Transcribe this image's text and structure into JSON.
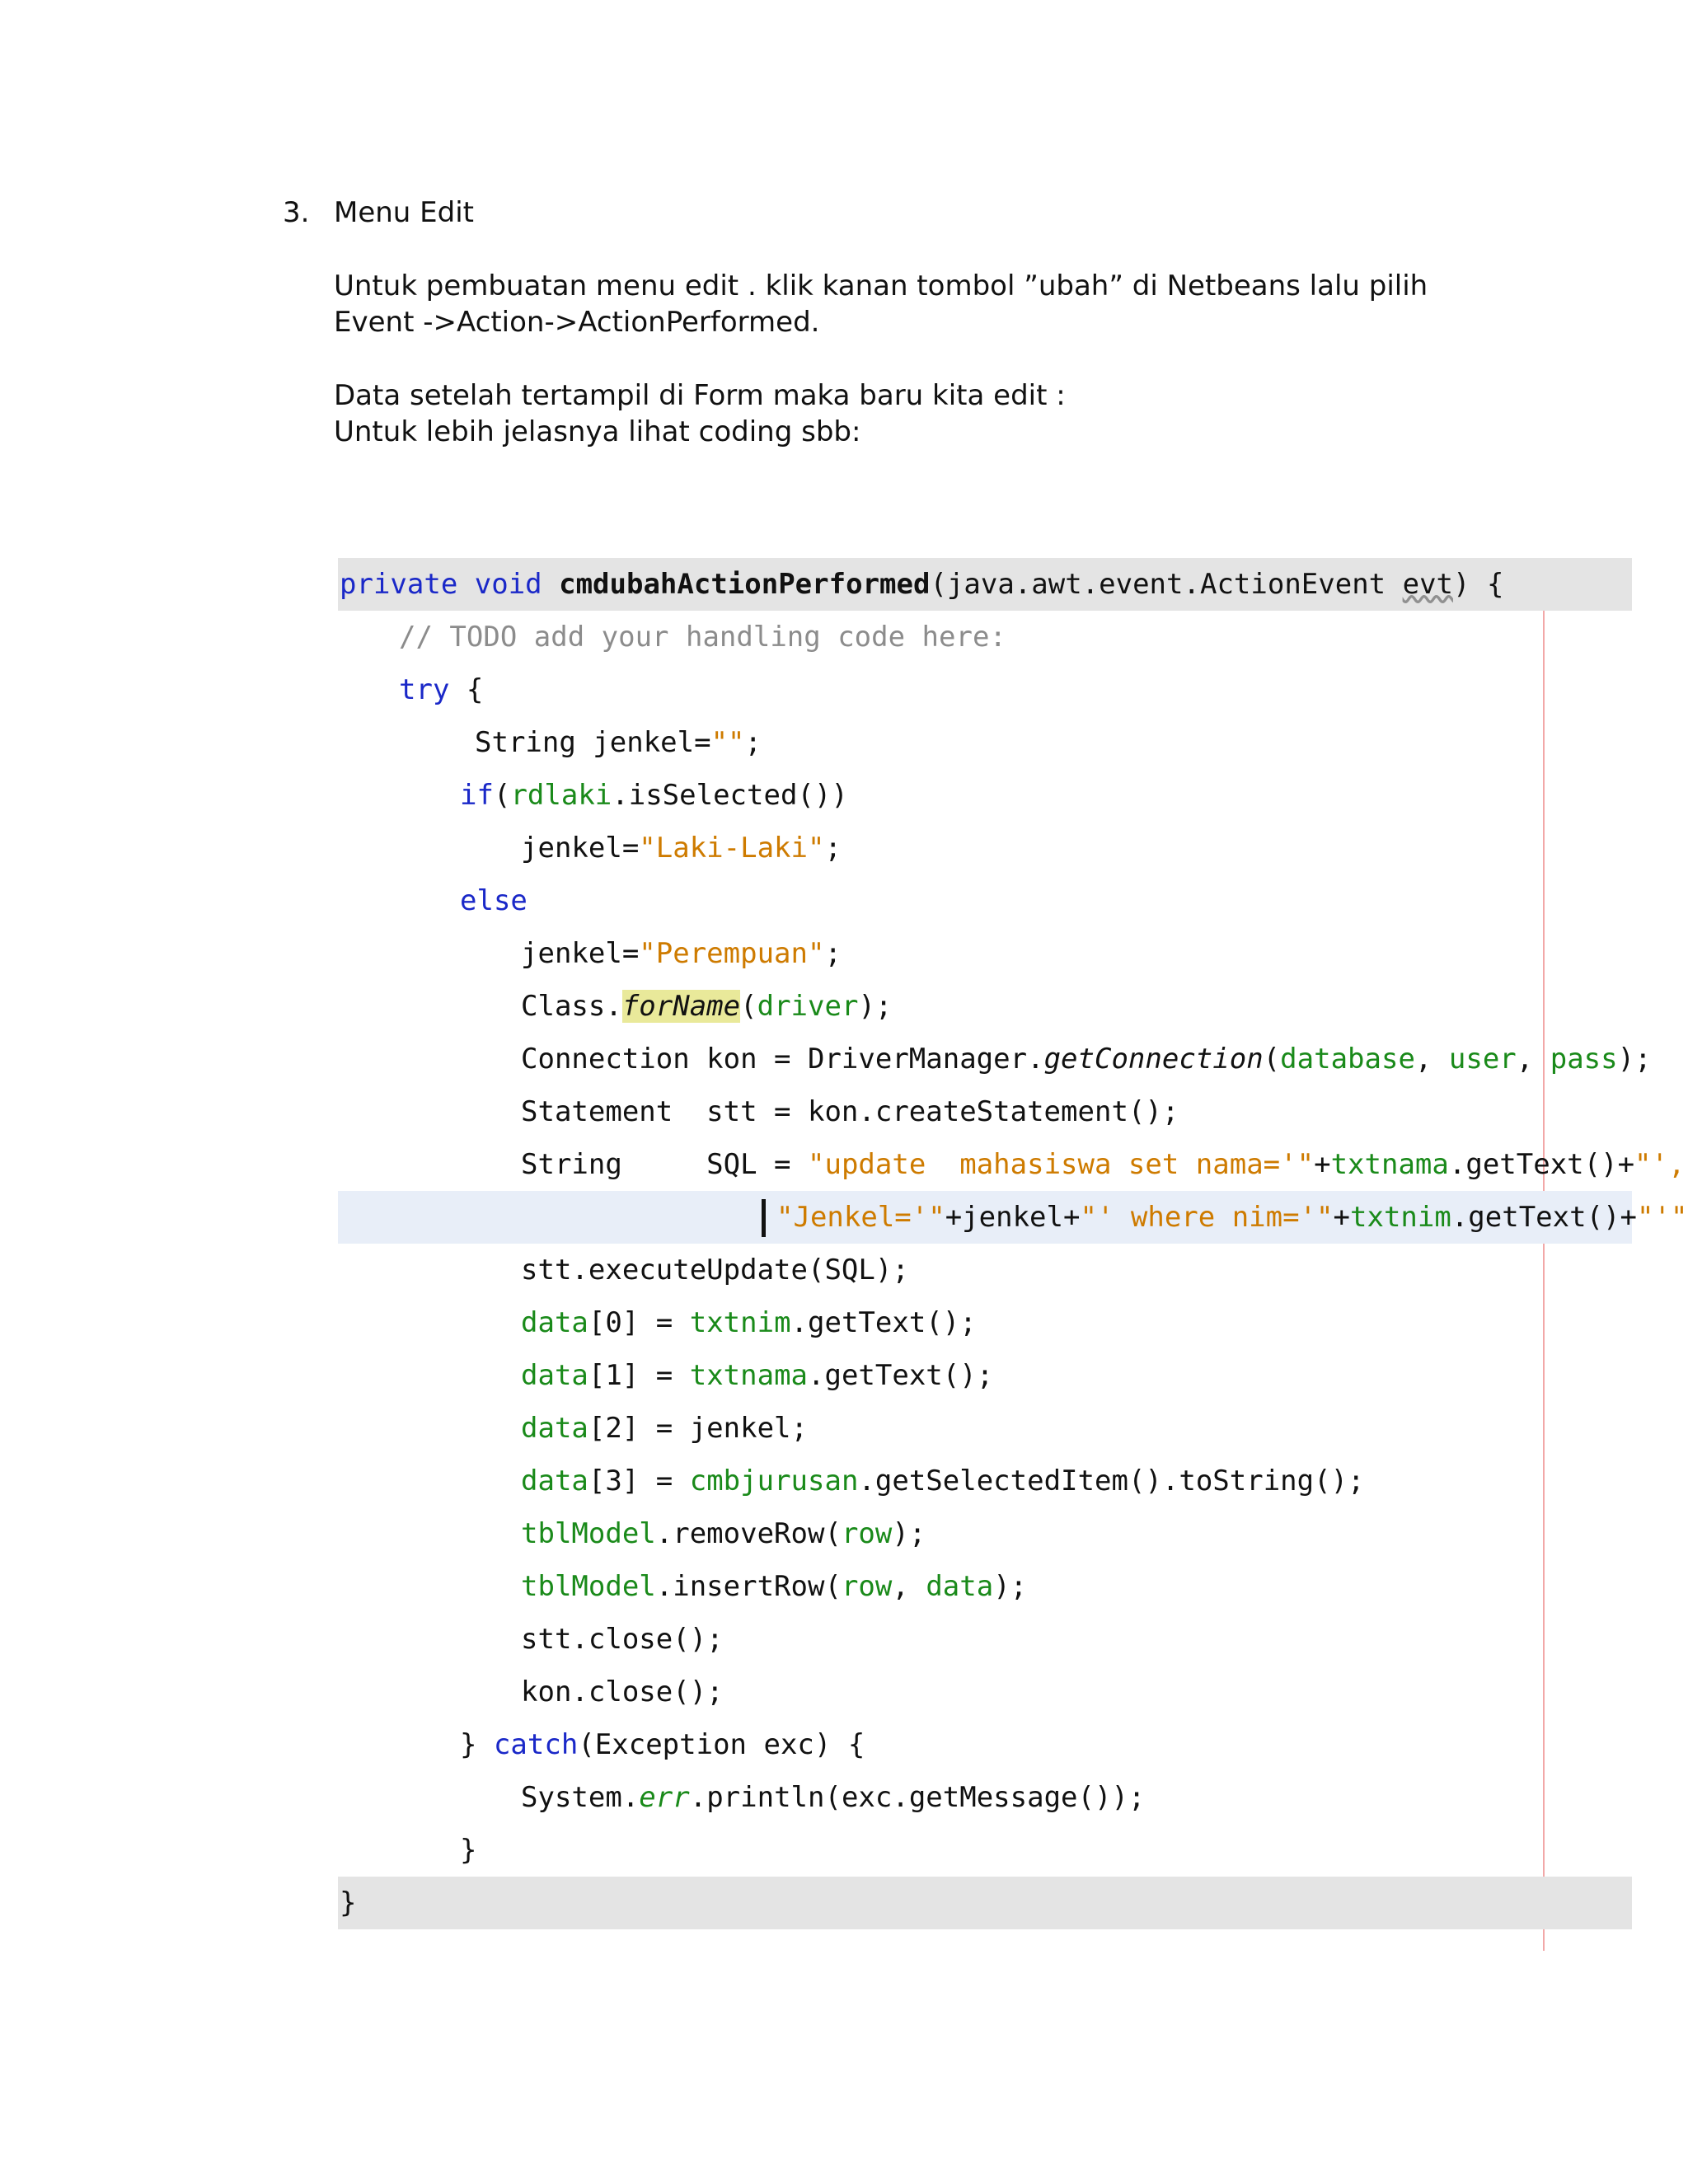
{
  "section": {
    "number": "3.",
    "title": "Menu Edit",
    "paragraphs": [
      "Untuk pembuatan menu edit . klik kanan tombol ”ubah” di Netbeans lalu pilih",
      "Event ->Action->ActionPerformed.",
      "Data setelah tertampil di Form maka baru kita edit :",
      "Untuk lebih jelasnya lihat coding sbb:"
    ]
  },
  "code_lines": [
    [
      "private void ",
      "cmdubahActionPerformed",
      "(java.awt.event.ActionEvent ",
      "evt",
      ") {"
    ],
    [
      "// TODO add your handling code here:"
    ],
    [
      "try",
      " {"
    ],
    [
      "String jenkel=",
      "\"\"",
      ";"
    ],
    [
      "if",
      "(",
      "rdlaki",
      ".isSelected())"
    ],
    [
      "jenkel=",
      "\"Laki-Laki\"",
      ";"
    ],
    [
      "else"
    ],
    [
      "jenkel=",
      "\"Perempuan\"",
      ";"
    ],
    [
      "Class.",
      "forName",
      "(",
      "driver",
      ");"
    ],
    [
      "Connection kon = DriverManager.",
      "getConnection",
      "(",
      "database",
      ", ",
      "user",
      ", ",
      "pass",
      ");"
    ],
    [
      "Statement  stt = kon.createStatement();"
    ],
    [
      "String     SQL = ",
      "\"update  mahasiswa set nama='\"",
      "+",
      "txtnama",
      ".getText()+",
      "\"',\"",
      " +"
    ],
    [
      "\"Jenkel='\"",
      "+jenkel+",
      "\"' where nim='\"",
      "+",
      "txtnim",
      ".getText()+",
      "\"'\"",
      ";"
    ],
    [
      "stt.executeUpdate(SQL);"
    ],
    [
      "data",
      "[0] = ",
      "txtnim",
      ".getText();"
    ],
    [
      "data",
      "[1] = ",
      "txtnama",
      ".getText();"
    ],
    [
      "data",
      "[2] = jenkel;"
    ],
    [
      "data",
      "[3] = ",
      "cmbjurusan",
      ".getSelectedItem().toString();"
    ],
    [
      "tblModel",
      ".removeRow(",
      "row",
      ");"
    ],
    [
      "tblModel",
      ".insertRow(",
      "row",
      ", ",
      "data",
      ");"
    ],
    [
      "stt.close();"
    ],
    [
      "kon.close();"
    ],
    [
      "} ",
      "catch",
      "(Exception exc) {"
    ],
    [
      "System.",
      "err",
      ".println(exc.getMessage());"
    ],
    [
      "}"
    ],
    [
      "}"
    ]
  ],
  "colors": {
    "keyword": "#1a28c8",
    "string": "#ce7b00",
    "field": "#1a8a1a",
    "comment": "#8c8c8c",
    "highlight": "#e9e99a"
  }
}
